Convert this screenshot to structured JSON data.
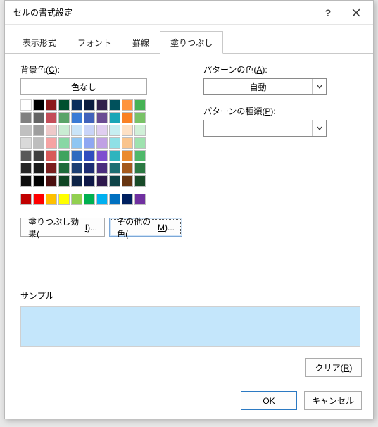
{
  "title": "セルの書式設定",
  "tabs": [
    "表示形式",
    "フォント",
    "罫線",
    "塗りつぶし"
  ],
  "active_tab": 3,
  "left": {
    "bgcolor_label_pre": "背景色(",
    "bgcolor_mnemonic": "C",
    "bgcolor_label_post": "):",
    "no_color_label": "色なし",
    "fill_effects_label": "塗りつぶし効果(",
    "fill_effects_mnemonic": "I",
    "fill_effects_post": ")...",
    "more_colors_label": "その他の色(",
    "more_colors_mnemonic": "M",
    "more_colors_post": ")..."
  },
  "right": {
    "pattern_color_label_pre": "パターンの色(",
    "pattern_color_mnemonic": "A",
    "pattern_color_label_post": "):",
    "pattern_color_value": "自動",
    "pattern_type_label_pre": "パターンの種類(",
    "pattern_type_mnemonic": "P",
    "pattern_type_label_post": "):",
    "pattern_type_value": ""
  },
  "sample": {
    "label": "サンプル",
    "color": "#c4e6fb"
  },
  "buttons": {
    "clear_pre": "クリア(",
    "clear_mnemonic": "R",
    "clear_post": ")",
    "ok": "OK",
    "cancel": "キャンセル"
  },
  "palette_main": [
    [
      "#ffffff",
      "#000000",
      "#8b1a1a",
      "#00502f",
      "#0b2d5c",
      "#0b1d3f",
      "#32214b",
      "#00515c",
      "#ff943e",
      "#46b255"
    ],
    [
      "#808080",
      "#636363",
      "#c44d58",
      "#5aa469",
      "#3a7bd5",
      "#4062bb",
      "#6a4c93",
      "#1aa6b7",
      "#f98125",
      "#79c267"
    ],
    [
      "#c0c0c0",
      "#9e9e9e",
      "#eec9c9",
      "#c9ecd3",
      "#c9e4f8",
      "#c9d4f8",
      "#e0cef0",
      "#c7eef1",
      "#fde0c4",
      "#d0f0d8"
    ],
    [
      "#d9d9d9",
      "#bdbdbd",
      "#f6a3a3",
      "#88d7a4",
      "#8fc6f2",
      "#8fa7f2",
      "#c0a1e4",
      "#8fe0e6",
      "#f9c48d",
      "#9ee2ae"
    ],
    [
      "#595959",
      "#404040",
      "#d85a5a",
      "#3fa35f",
      "#2f6bbf",
      "#2f4dbf",
      "#7e4ecf",
      "#2fb4be",
      "#ea8a2e",
      "#4fb86a"
    ],
    [
      "#262626",
      "#1a1a1a",
      "#7a1e1e",
      "#1e6b3a",
      "#1c3f73",
      "#1c2c73",
      "#4b2c7e",
      "#1c6e73",
      "#a5591c",
      "#2c7a43"
    ],
    [
      "#0d0d0d",
      "#000000",
      "#4a0f0f",
      "#0f4523",
      "#0e2447",
      "#0e1847",
      "#2d184c",
      "#0e4347",
      "#663410",
      "#184a28"
    ]
  ],
  "palette_std": [
    "#c00000",
    "#ff0000",
    "#ffc000",
    "#ffff00",
    "#92d050",
    "#00b050",
    "#00b0f0",
    "#0070c0",
    "#002060",
    "#7030a0"
  ]
}
